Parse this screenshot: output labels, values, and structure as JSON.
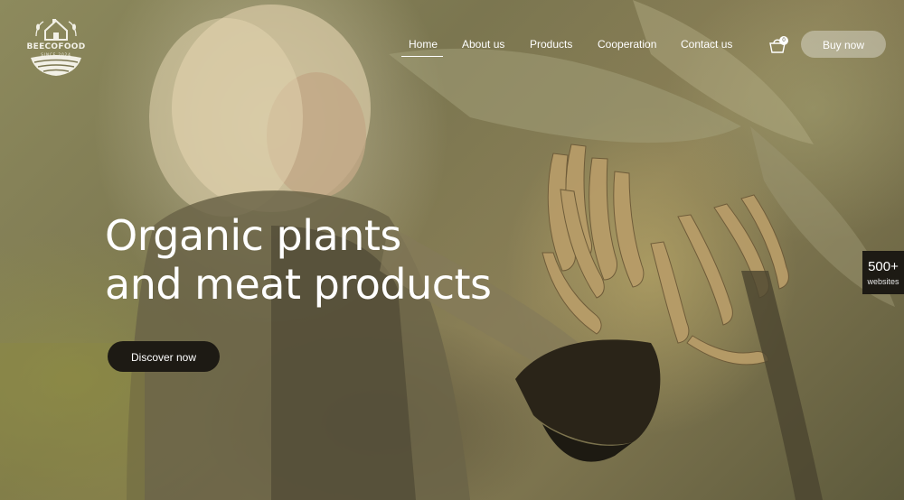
{
  "brand": {
    "name": "BEECOFOOD",
    "tagline": "SINCE 2024"
  },
  "nav": {
    "items": [
      {
        "label": "Home",
        "active": true
      },
      {
        "label": "About us",
        "active": false
      },
      {
        "label": "Products",
        "active": false
      },
      {
        "label": "Cooperation",
        "active": false
      },
      {
        "label": "Contact us",
        "active": false
      }
    ],
    "cart_count": "0",
    "buy_label": "Buy now"
  },
  "hero": {
    "headline_line1": "Organic plants",
    "headline_line2": "and meat products",
    "cta_label": "Discover now"
  },
  "side_badge": {
    "count": "500+",
    "label": "websites"
  },
  "colors": {
    "text": "#ffffff",
    "dark_button": "#1d1a14",
    "overlay_tint": "#7b7650"
  },
  "icons": [
    "logo-emblem-icon",
    "cart-icon"
  ]
}
